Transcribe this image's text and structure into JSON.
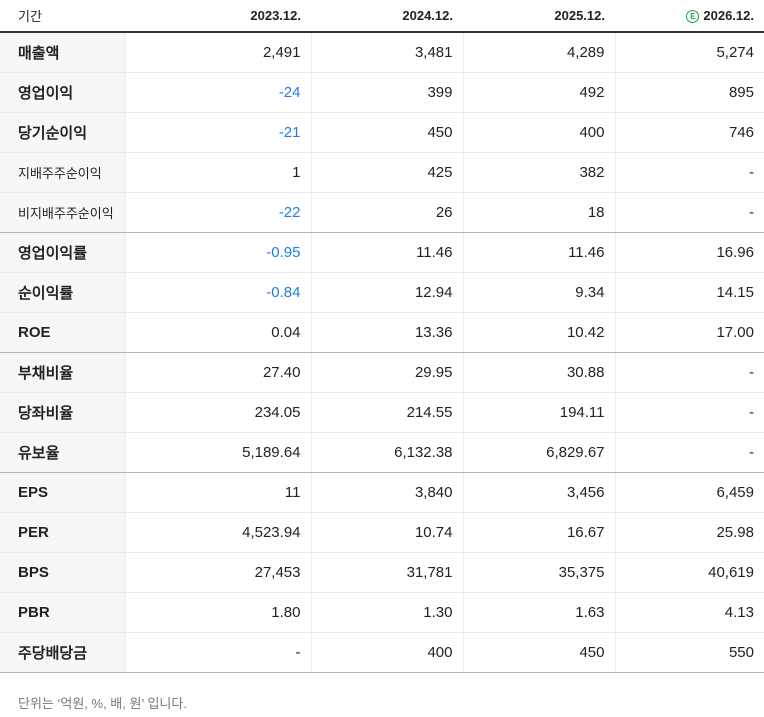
{
  "table": {
    "period_label": "기간",
    "estimate_badge": "E",
    "years": [
      "2023.12.",
      "2024.12.",
      "2025.12.",
      "2026.12."
    ],
    "rows": [
      {
        "label": "매출액",
        "values": [
          "2,491",
          "3,481",
          "4,289",
          "5,274"
        ],
        "negatives": [
          false,
          false,
          false,
          false
        ]
      },
      {
        "label": "영업이익",
        "values": [
          "-24",
          "399",
          "492",
          "895"
        ],
        "negatives": [
          true,
          false,
          false,
          false
        ]
      },
      {
        "label": "당기순이익",
        "values": [
          "-21",
          "450",
          "400",
          "746"
        ],
        "negatives": [
          true,
          false,
          false,
          false
        ]
      },
      {
        "label": "지배주주순이익",
        "values": [
          "1",
          "425",
          "382",
          "-"
        ],
        "negatives": [
          false,
          false,
          false,
          false
        ]
      },
      {
        "label": "비지배주주순이익",
        "values": [
          "-22",
          "26",
          "18",
          "-"
        ],
        "negatives": [
          true,
          false,
          false,
          false
        ]
      },
      {
        "label": "영업이익률",
        "values": [
          "-0.95",
          "11.46",
          "11.46",
          "16.96"
        ],
        "negatives": [
          true,
          false,
          false,
          false
        ]
      },
      {
        "label": "순이익률",
        "values": [
          "-0.84",
          "12.94",
          "9.34",
          "14.15"
        ],
        "negatives": [
          true,
          false,
          false,
          false
        ]
      },
      {
        "label": "ROE",
        "values": [
          "0.04",
          "13.36",
          "10.42",
          "17.00"
        ],
        "negatives": [
          false,
          false,
          false,
          false
        ]
      },
      {
        "label": "부채비율",
        "values": [
          "27.40",
          "29.95",
          "30.88",
          "-"
        ],
        "negatives": [
          false,
          false,
          false,
          false
        ]
      },
      {
        "label": "당좌비율",
        "values": [
          "234.05",
          "214.55",
          "194.11",
          "-"
        ],
        "negatives": [
          false,
          false,
          false,
          false
        ]
      },
      {
        "label": "유보율",
        "values": [
          "5,189.64",
          "6,132.38",
          "6,829.67",
          "-"
        ],
        "negatives": [
          false,
          false,
          false,
          false
        ]
      },
      {
        "label": "EPS",
        "values": [
          "11",
          "3,840",
          "3,456",
          "6,459"
        ],
        "negatives": [
          false,
          false,
          false,
          false
        ]
      },
      {
        "label": "PER",
        "values": [
          "4,523.94",
          "10.74",
          "16.67",
          "25.98"
        ],
        "negatives": [
          false,
          false,
          false,
          false
        ]
      },
      {
        "label": "BPS",
        "values": [
          "27,453",
          "31,781",
          "35,375",
          "40,619"
        ],
        "negatives": [
          false,
          false,
          false,
          false
        ]
      },
      {
        "label": "PBR",
        "values": [
          "1.80",
          "1.30",
          "1.63",
          "4.13"
        ],
        "negatives": [
          false,
          false,
          false,
          false
        ]
      },
      {
        "label": "주당배당금",
        "values": [
          "-",
          "400",
          "450",
          "550"
        ],
        "negatives": [
          false,
          false,
          false,
          false
        ]
      }
    ]
  },
  "footnote": "단위는 ‘억원, %, 배, 원’ 입니다.",
  "colors": {
    "negative": "#1e7ee0",
    "estimate": "#16a34a"
  }
}
